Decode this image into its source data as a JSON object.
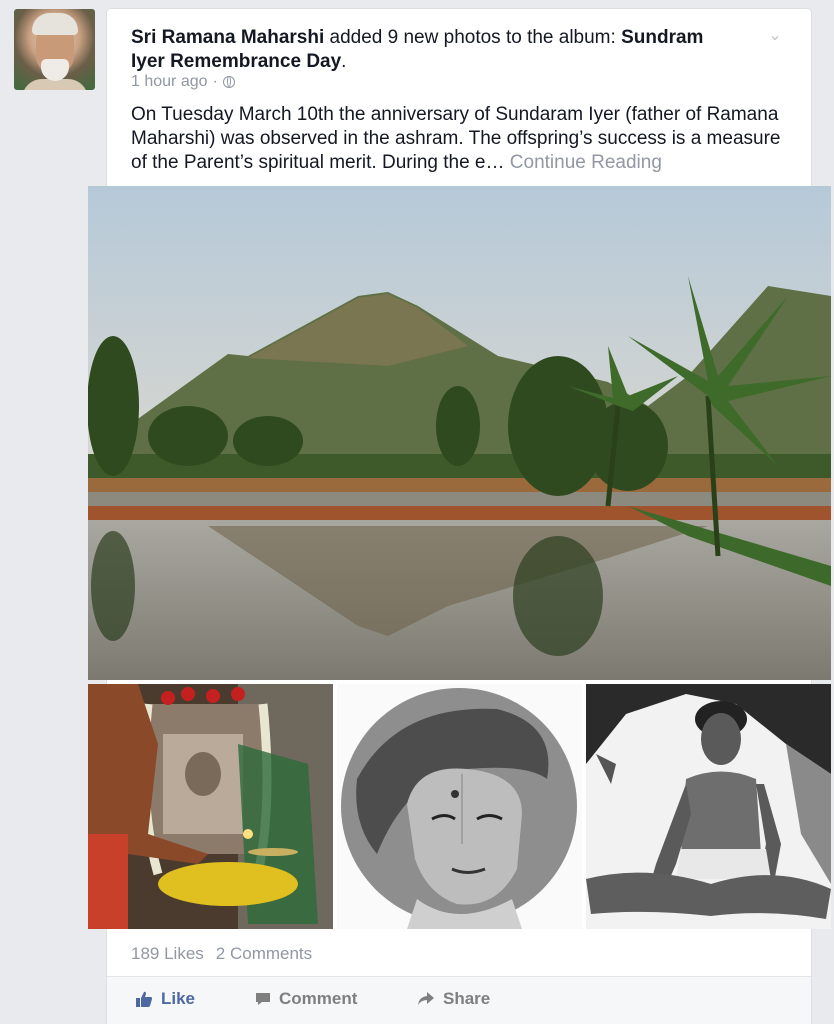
{
  "post": {
    "author": "Sri Ramana Maharshi",
    "action_text": " added 9 new photos to the album: ",
    "album": "Sundram Iyer Remembrance Day",
    "headline_end": ".",
    "time": "1 hour ago",
    "separator": "·",
    "body": "On Tuesday March 10th the anniversary of Sundaram Iyer (father of Ramana Maharshi) was observed in the ashram. The offspring’s success is a measure of the Parent’s spiritual merit. During the e…",
    "continue_label": "Continue Reading",
    "likes": "189 Likes",
    "comments": "2 Comments"
  },
  "actions": {
    "like": "Like",
    "comment": "Comment",
    "share": "Share"
  },
  "icons": {
    "options": "chevron-down-icon",
    "privacy": "globe-icon",
    "like": "thumbs-up-icon",
    "comment": "comment-bubble-icon",
    "share": "share-arrow-icon"
  },
  "colors": {
    "background": "#e9eaed",
    "text": "#141823",
    "muted": "#9197a3",
    "like_blue": "#4e69a2"
  }
}
